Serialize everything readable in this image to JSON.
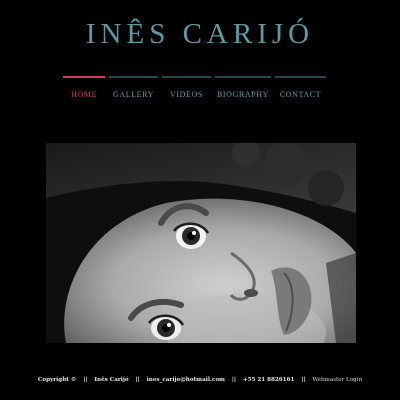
{
  "site": {
    "title": "INÊS CARIJÓ"
  },
  "nav": {
    "items": [
      {
        "label": "HOME",
        "active": true
      },
      {
        "label": "GALLERY",
        "active": false
      },
      {
        "label": "VIDEOS",
        "active": false
      },
      {
        "label": "BIOGRAPHY",
        "active": false
      },
      {
        "label": "CONTACT",
        "active": false
      }
    ]
  },
  "hero": {
    "image": "black-and-white portrait photo"
  },
  "footer": {
    "copyright": "Copyright ©",
    "name": "Inês  Carijó",
    "email": "ines_carijo@hotmail.com",
    "phone": "+55 21 8826161",
    "separator": "||",
    "login": "Webmaster Login"
  },
  "colors": {
    "background": "#000000",
    "title": "#5d9aa4",
    "nav_text": "#5e9ea6",
    "nav_active": "#d2386f",
    "nav_border": "#244a4f",
    "footer_text": "#e8e8e8"
  }
}
